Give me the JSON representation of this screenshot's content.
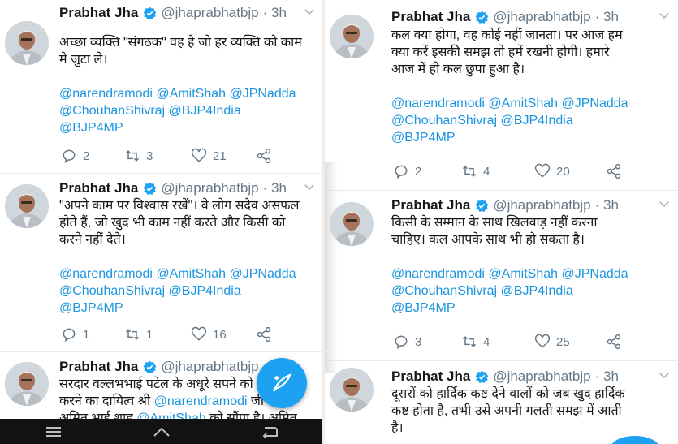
{
  "colors": {
    "accent": "#1da1f2",
    "mention": "#1b95e0",
    "text": "#14171a",
    "muted": "#657786"
  },
  "left_tweets": [
    {
      "name": "Prabhat Jha",
      "handle": "@jhaprabhatbjp",
      "time": "· 3h",
      "text": [
        "अच्छा व्यक्ति \"संगठक\" वह है जो हर व्यक्ति को काम",
        "मे जुटा ले।"
      ],
      "mentions": [
        "@narendramodi @AmitShah @JPNadda",
        "@ChouhanShivraj @BJP4India",
        "@BJP4MP"
      ],
      "replies": "2",
      "retweets": "3",
      "likes": "21"
    },
    {
      "name": "Prabhat Jha",
      "handle": "@jhaprabhatbjp",
      "time": "· 3h",
      "text": [
        "\"अपने काम पर विश्वास रखें\"। वे लोग सदैव असफल",
        "होते हैं, जो खुद भी काम नहीं करते और किसी को",
        "करने नहीं देते।"
      ],
      "mentions": [
        "@narendramodi @AmitShah @JPNadda",
        "@ChouhanShivraj @BJP4India",
        "@BJP4MP"
      ],
      "replies": "1",
      "retweets": "1",
      "likes": "16"
    },
    {
      "name": "Prabhat Jha",
      "handle": "@jhaprabhatbjp",
      "time": "· 3h",
      "text_a": "सरदार वल्लभभाई पटेल के अधूरे सपने को",
      "text_b": "करने का दायित्व श्री ",
      "mention_b": "@narendramodi",
      "text_b2": " जी",
      "text_c": "अमित भाई शाह ",
      "mention_c": "@AmitShah",
      "text_c2": " को सौंपा है। अमित"
    }
  ],
  "right_tweets": [
    {
      "name": "Prabhat Jha",
      "handle": "@jhaprabhatbjp",
      "time": "· 3h",
      "text": [
        "कल क्या होगा, वह कोई नहीं जानता। पर आज हम",
        "क्या करें इसकी समझ तो हमें रखनी होगी। हमारे",
        "आज में ही कल छुपा हुआ है।"
      ],
      "mentions": [
        "@narendramodi @AmitShah @JPNadda",
        "@ChouhanShivraj @BJP4India",
        "@BJP4MP"
      ],
      "replies": "2",
      "retweets": "4",
      "likes": "20"
    },
    {
      "name": "Prabhat Jha",
      "handle": "@jhaprabhatbjp",
      "time": "· 3h",
      "text": [
        "किसी के सम्मान के साथ खिलवाड़ नहीं करना",
        "चाहिए। कल आपके साथ भी हो सकता है।"
      ],
      "mentions": [
        "@narendramodi @AmitShah @JPNadda",
        "@ChouhanShivraj @BJP4India",
        "@BJP4MP"
      ],
      "replies": "3",
      "retweets": "4",
      "likes": "25"
    },
    {
      "name": "Prabhat Jha",
      "handle": "@jhaprabhatbjp",
      "time": "· 3h",
      "text": [
        "दूसरों को हार्दिक कष्ट देने वालों को जब खुद हार्दिक",
        "कष्ट होता है, तभी उसे अपनी गलती समझ में आती",
        "है।"
      ]
    }
  ],
  "icons": {
    "reply": "reply-icon",
    "retweet": "retweet-icon",
    "like": "heart-icon",
    "share": "share-icon",
    "verified": "verified-badge-icon",
    "more": "chevron-down-icon",
    "compose": "compose-tweet-icon",
    "nav": [
      "menu-icon",
      "home-icon",
      "back-icon"
    ]
  }
}
